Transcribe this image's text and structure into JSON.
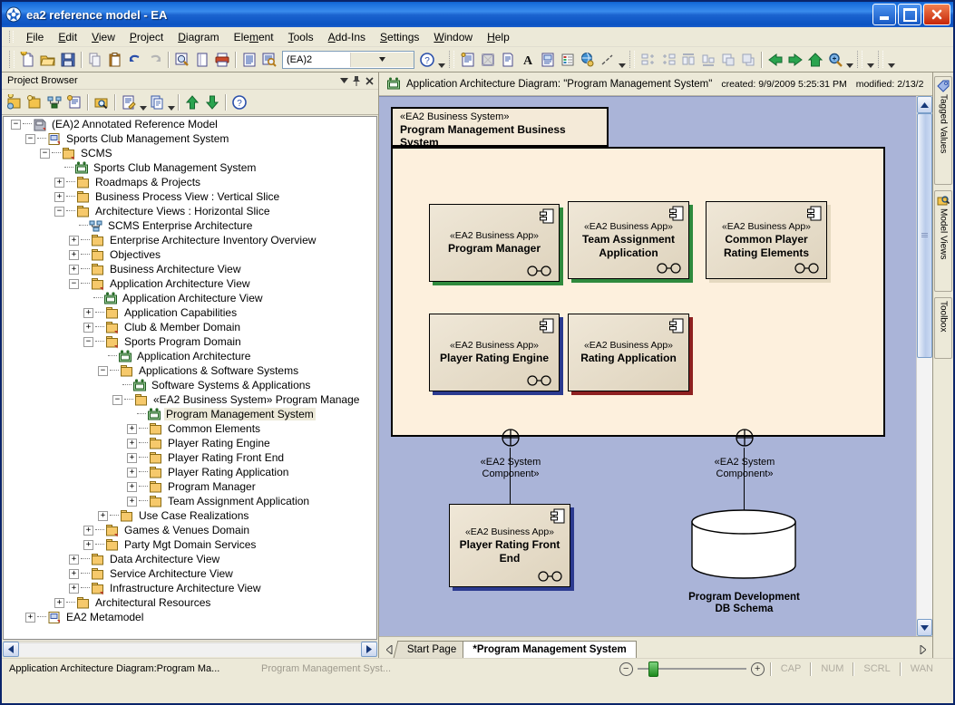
{
  "window": {
    "title": "ea2 reference model - EA",
    "app_icon": "ea-logo-icon",
    "minimize": "Minimize",
    "maximize": "Maximize",
    "close": "Close"
  },
  "menubar": [
    {
      "label": "File",
      "accel": "F"
    },
    {
      "label": "Edit",
      "accel": "E"
    },
    {
      "label": "View",
      "accel": "V"
    },
    {
      "label": "Project",
      "accel": "P"
    },
    {
      "label": "Diagram",
      "accel": "D"
    },
    {
      "label": "Element",
      "accel": "m"
    },
    {
      "label": "Tools",
      "accel": "T"
    },
    {
      "label": "Add-Ins",
      "accel": "A"
    },
    {
      "label": "Settings",
      "accel": "S"
    },
    {
      "label": "Window",
      "accel": "W"
    },
    {
      "label": "Help",
      "accel": "H"
    }
  ],
  "toolbar": {
    "model_combo_value": "(EA)2",
    "buttons": [
      "new-project-icon",
      "open-project-icon",
      "save-icon",
      "copy-icon",
      "paste-icon",
      "undo-icon",
      "redo-icon",
      "search-icon",
      "page-icon",
      "print-icon",
      "report-icon",
      "find-in-project-icon"
    ],
    "help_icon": "help-icon",
    "buttons2": [
      "properties-icon",
      "swimlanes-icon",
      "notes-icon",
      "text-icon",
      "document-icon",
      "legend-icon",
      "web-icon",
      "line-style-icon"
    ],
    "buttons3": [
      "align-left-icon",
      "align-right-icon",
      "align-top-icon",
      "align-bottom-icon",
      "bring-forward-icon",
      "send-backward-icon",
      "back-icon",
      "forward-icon",
      "home-icon",
      "zoom-icon"
    ]
  },
  "project_browser": {
    "title": "Project Browser",
    "header_buttons": [
      "chevron-down-icon",
      "pin-icon",
      "close-icon"
    ],
    "toolbar_buttons": [
      "new-model-icon",
      "new-package-icon",
      "new-diagram-icon",
      "new-element-icon",
      "find-icon",
      "edit-notes-icon",
      "properties-list-icon",
      "move-up-icon",
      "move-down-icon",
      "help-icon"
    ],
    "tree": [
      {
        "label": "(EA)2 Annotated Reference Model",
        "depth": 0,
        "expander": "minus",
        "icon": "model-icon"
      },
      {
        "label": "Sports Club Management System",
        "depth": 1,
        "expander": "minus",
        "icon": "view-icon"
      },
      {
        "label": "SCMS",
        "depth": 2,
        "expander": "minus",
        "icon": "package-doc-icon"
      },
      {
        "label": "Sports Club Management System",
        "depth": 3,
        "expander": "none",
        "icon": "diagram-icon"
      },
      {
        "label": "Roadmaps & Projects",
        "depth": 3,
        "expander": "plus",
        "icon": "package-icon"
      },
      {
        "label": "Business Process View : Vertical Slice",
        "depth": 3,
        "expander": "plus",
        "icon": "package-icon"
      },
      {
        "label": "Architecture Views : Horizontal Slice",
        "depth": 3,
        "expander": "minus",
        "icon": "package-icon"
      },
      {
        "label": "SCMS Enterprise Architecture",
        "depth": 4,
        "expander": "none",
        "icon": "component-diagram-icon"
      },
      {
        "label": "Enterprise Architecture Inventory Overview",
        "depth": 4,
        "expander": "plus",
        "icon": "package-icon"
      },
      {
        "label": "Objectives",
        "depth": 4,
        "expander": "plus",
        "icon": "package-icon"
      },
      {
        "label": "Business Architecture View",
        "depth": 4,
        "expander": "plus",
        "icon": "package-icon"
      },
      {
        "label": "Application Architecture View",
        "depth": 4,
        "expander": "minus",
        "icon": "package-doc-icon"
      },
      {
        "label": "Application Architecture View",
        "depth": 5,
        "expander": "none",
        "icon": "diagram-icon"
      },
      {
        "label": "Application Capabilities",
        "depth": 5,
        "expander": "plus",
        "icon": "package-icon"
      },
      {
        "label": "Club & Member Domain",
        "depth": 5,
        "expander": "plus",
        "icon": "package-doc-icon"
      },
      {
        "label": "Sports Program Domain",
        "depth": 5,
        "expander": "minus",
        "icon": "package-doc-icon"
      },
      {
        "label": "Application Architecture",
        "depth": 6,
        "expander": "none",
        "icon": "diagram-icon"
      },
      {
        "label": "Applications & Software Systems",
        "depth": 6,
        "expander": "minus",
        "icon": "package-icon"
      },
      {
        "label": "Software Systems & Applications",
        "depth": 7,
        "expander": "none",
        "icon": "diagram-icon"
      },
      {
        "label": "«EA2 Business System» Program Manage",
        "depth": 7,
        "expander": "minus",
        "icon": "package-icon"
      },
      {
        "label": "Program Management System",
        "depth": 8,
        "expander": "none",
        "icon": "diagram-icon",
        "selected": true
      },
      {
        "label": "Common Elements",
        "depth": 8,
        "expander": "plus",
        "icon": "package-icon"
      },
      {
        "label": "Player Rating Engine",
        "depth": 8,
        "expander": "plus",
        "icon": "package-icon"
      },
      {
        "label": "Player Rating Front End",
        "depth": 8,
        "expander": "plus",
        "icon": "package-icon"
      },
      {
        "label": "Player Rating Application",
        "depth": 8,
        "expander": "plus",
        "icon": "package-icon"
      },
      {
        "label": "Program Manager",
        "depth": 8,
        "expander": "plus",
        "icon": "package-icon"
      },
      {
        "label": "Team Assignment Application",
        "depth": 8,
        "expander": "plus",
        "icon": "package-icon"
      },
      {
        "label": "Use Case Realizations",
        "depth": 6,
        "expander": "plus",
        "icon": "package-icon"
      },
      {
        "label": "Games & Venues Domain",
        "depth": 5,
        "expander": "plus",
        "icon": "package-doc-icon"
      },
      {
        "label": "Party Mgt Domain Services",
        "depth": 5,
        "expander": "plus",
        "icon": "package-icon"
      },
      {
        "label": "Data Architecture View",
        "depth": 4,
        "expander": "plus",
        "icon": "package-icon"
      },
      {
        "label": "Service Architecture View",
        "depth": 4,
        "expander": "plus",
        "icon": "package-icon"
      },
      {
        "label": "Infrastructure Architecture View",
        "depth": 4,
        "expander": "plus",
        "icon": "package-doc-icon"
      },
      {
        "label": "Architectural Resources",
        "depth": 3,
        "expander": "plus",
        "icon": "package-icon"
      },
      {
        "label": "EA2 Metamodel",
        "depth": 1,
        "expander": "plus",
        "icon": "view-icon"
      }
    ]
  },
  "diagram": {
    "icon": "diagram-icon",
    "name": "Application Architecture Diagram: \"Program Management System\"",
    "created_label": "created: 9/9/2009 5:25:31 PM",
    "modified_label": "modified: 2/13/2",
    "canvas_color": "#aab4d8",
    "package": {
      "stereotype": "«EA2 Business System»",
      "name": "Program Management Business System",
      "fill": "#fdf0dd",
      "tab_fill": "#f4ead8"
    },
    "components": [
      {
        "stereotype": "«EA2 Business App»",
        "name": "Program Manager",
        "name2": "",
        "shadow": "#2f8a3d",
        "lollipop": true
      },
      {
        "stereotype": "«EA2 Business App»",
        "name": "Team Assignment",
        "name2": "Application",
        "shadow": "#2f8a3d",
        "lollipop": true
      },
      {
        "stereotype": "«EA2 Business App»",
        "name": "Common Player",
        "name2": "Rating Elements",
        "shadow": "#d8cdb6",
        "lollipop": true
      },
      {
        "stereotype": "«EA2 Business App»",
        "name": "Player Rating Engine",
        "name2": "",
        "shadow": "#2b3a8f",
        "lollipop": true
      },
      {
        "stereotype": "«EA2 Business App»",
        "name": "Rating Application",
        "name2": "",
        "shadow": "#8e2020",
        "lollipop": false
      }
    ],
    "front_end": {
      "stereotype": "«EA2 Business App»",
      "name": "Player Rating Front",
      "name2": "End",
      "shadow": "#2b3a8f"
    },
    "connector_labels": [
      {
        "line1": "«EA2 System",
        "line2": "Component»"
      },
      {
        "line1": "«EA2 System",
        "line2": "Component»"
      }
    ],
    "database": {
      "line1": "Program Development",
      "line2": "DB Schema"
    }
  },
  "right_tabs": [
    {
      "label": "Tagged Values",
      "icon": "tag-icon"
    },
    {
      "label": "Model Views",
      "icon": "model-views-icon"
    },
    {
      "label": "Toolbox",
      "icon": "none"
    }
  ],
  "tabstrip": {
    "prev_icon": "prev-tab-icon",
    "next_icon": "next-tab-icon",
    "tabs": [
      {
        "label": "Start Page",
        "active": false
      },
      {
        "label": "*Program Management System",
        "active": true
      }
    ]
  },
  "statusbar": {
    "left": "Application Architecture Diagram:Program Ma...",
    "second": "Program Management Syst...",
    "zoom_out": "−",
    "zoom_in": "+",
    "indicators": [
      "CAP",
      "NUM",
      "SCRL",
      "WAN"
    ]
  }
}
